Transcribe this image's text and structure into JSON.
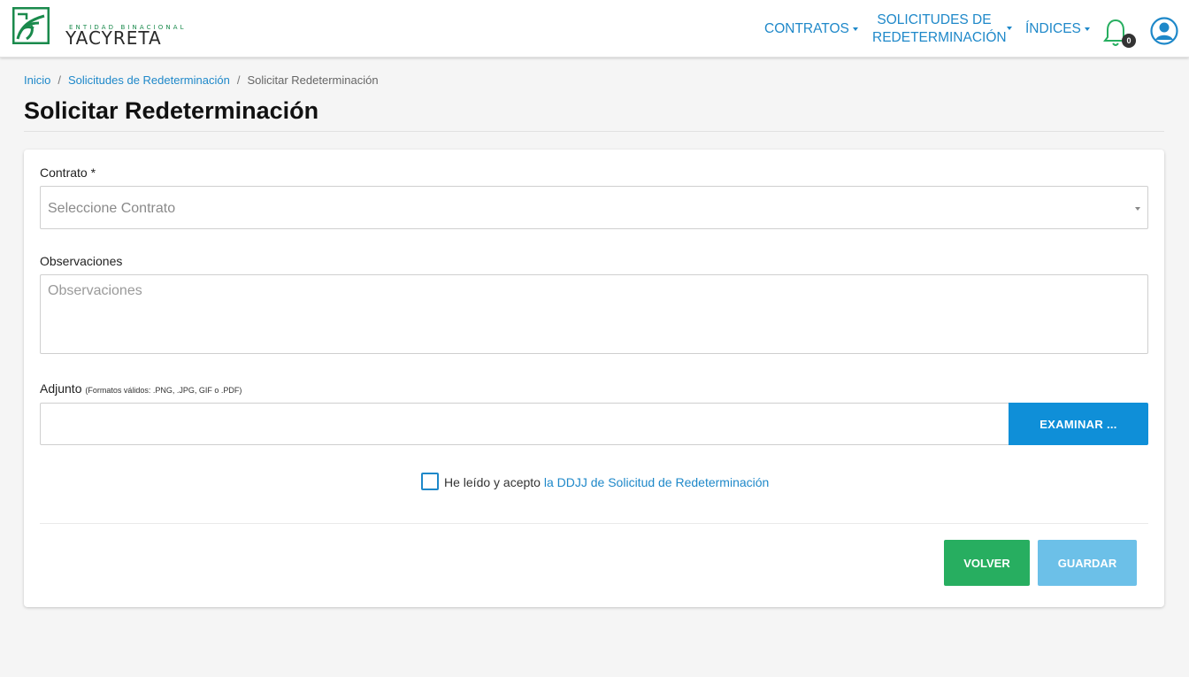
{
  "brand": {
    "subtitle": "ENTIDAD BINACIONAL",
    "name": "YACYRETA",
    "color": "#1a8a4c"
  },
  "nav": {
    "contratos": "CONTRATOS",
    "solicitudes_line1": "SOLICITUDES DE",
    "solicitudes_line2": "REDETERMINACIÓN",
    "indices": "ÍNDICES",
    "notifications_count": "0",
    "accent_color": "#1e88c9"
  },
  "breadcrumb": {
    "home": "Inicio",
    "section": "Solicitudes de Redeterminación",
    "current": "Solicitar Redeterminación"
  },
  "page_title": "Solicitar Redeterminación",
  "form": {
    "contrato_label": "Contrato *",
    "contrato_placeholder": "Seleccione Contrato",
    "observaciones_label": "Observaciones",
    "observaciones_placeholder": "Observaciones",
    "adjunto_label": "Adjunto",
    "adjunto_hint": "(Formatos válidos: .PNG, .JPG, GIF o .PDF)",
    "adjunto_value": "",
    "examinar_label": "EXAMINAR ...",
    "accept_text": "He leído y acepto",
    "accept_link": "la DDJJ de Solicitud de Redeterminación",
    "accept_checked": false
  },
  "actions": {
    "volver": "VOLVER",
    "guardar": "GUARDAR",
    "volver_color": "#27ae60",
    "guardar_color": "#6cc0e8"
  }
}
